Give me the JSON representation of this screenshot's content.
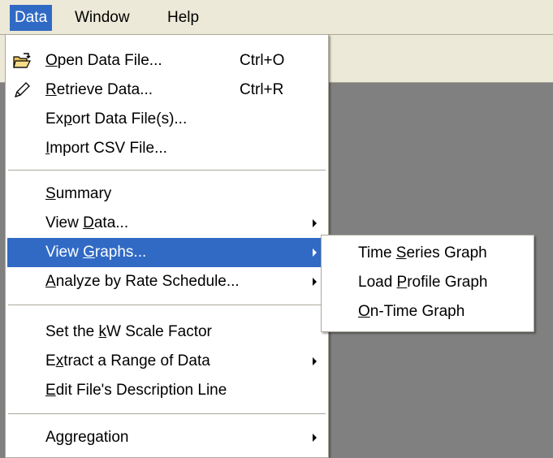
{
  "menubar": {
    "items": [
      {
        "label": "Data",
        "active": true
      },
      {
        "label": "Window",
        "active": false
      },
      {
        "label": "Help",
        "active": false
      }
    ]
  },
  "data_menu": {
    "items": [
      {
        "pre": "",
        "mn": "O",
        "post": "pen Data File...",
        "shortcut": "Ctrl+O",
        "icon": "open-folder-icon"
      },
      {
        "pre": "",
        "mn": "R",
        "post": "etrieve Data...",
        "shortcut": "Ctrl+R",
        "icon": "pencil-icon"
      },
      {
        "pre": "Ex",
        "mn": "p",
        "post": "ort Data File(s)..."
      },
      {
        "pre": "",
        "mn": "I",
        "post": "mport CSV File..."
      },
      {
        "pre": "",
        "mn": "S",
        "post": "ummary"
      },
      {
        "pre": "View ",
        "mn": "D",
        "post": "ata...",
        "submenu": true
      },
      {
        "pre": "View ",
        "mn": "G",
        "post": "raphs...",
        "submenu": true,
        "highlighted": true
      },
      {
        "pre": "",
        "mn": "A",
        "post": "nalyze by Rate Schedule...",
        "submenu": true
      },
      {
        "pre": "Set the ",
        "mn": "k",
        "post": "W Scale Factor"
      },
      {
        "pre": "E",
        "mn": "x",
        "post": "tract a Range of Data",
        "submenu": true
      },
      {
        "pre": "",
        "mn": "E",
        "post": "dit File's Description Line"
      },
      {
        "pre": "Aggregation",
        "mn": "",
        "post": "",
        "submenu": true
      }
    ]
  },
  "graphs_submenu": {
    "items": [
      {
        "pre": "Time ",
        "mn": "S",
        "post": "eries Graph"
      },
      {
        "pre": "Load ",
        "mn": "P",
        "post": "rofile Graph"
      },
      {
        "pre": "",
        "mn": "O",
        "post": "n-Time Graph"
      }
    ]
  }
}
